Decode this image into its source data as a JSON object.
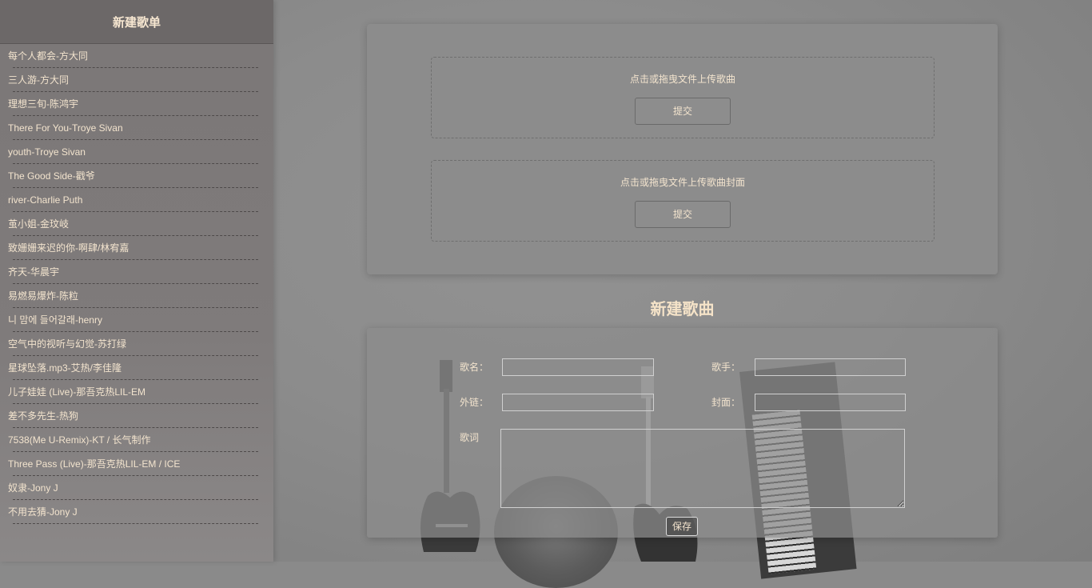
{
  "sidebar": {
    "title": "新建歌单",
    "songs": [
      "每个人都会-方大同",
      "三人游-方大同",
      "理想三旬-陈鸿宇",
      "There For You-Troye Sivan",
      "youth-Troye Sivan",
      "The Good Side-戳爷",
      "river-Charlie Puth",
      "茧小姐-金玟岐",
      "致姗姗来迟的你-啊肆/林宥嘉",
      "齐天-华晨宇",
      "易燃易爆炸-陈粒",
      "니 맘에 들어갈래-henry",
      "空气中的视听与幻觉-苏打绿",
      "星球坠落.mp3-艾热/李佳隆",
      "儿子娃娃 (Live)-那吾克热LIL-EM",
      "差不多先生-热狗",
      "7538(Me U-Remix)-KT / 长气制作",
      "Three Pass (Live)-那吾克热LIL-EM / ICE",
      "奴隶-Jony J",
      "不用去猜-Jony J"
    ]
  },
  "upload": {
    "song_hint": "点击或拖曳文件上传歌曲",
    "cover_hint": "点击或拖曳文件上传歌曲封面",
    "submit_label": "提交"
  },
  "form": {
    "section_title": "新建歌曲",
    "name_label": "歌名：",
    "singer_label": "歌手：",
    "link_label": "外链：",
    "cover_label": "封面：",
    "lyrics_label": "歌词",
    "save_label": "保存",
    "name_value": "",
    "singer_value": "",
    "link_value": "",
    "cover_value": "",
    "lyrics_value": ""
  }
}
